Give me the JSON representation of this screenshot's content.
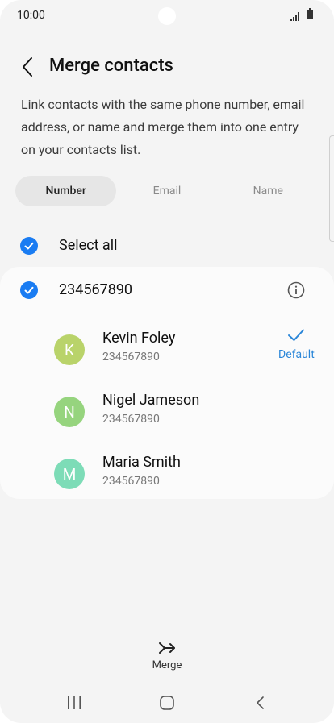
{
  "status_bar": {
    "time": "10:00"
  },
  "header": {
    "title": "Merge contacts"
  },
  "description": "Link contacts with the same phone number, email address, or name and merge them into one entry on your contacts list.",
  "tabs": [
    {
      "label": "Number",
      "active": true
    },
    {
      "label": "Email",
      "active": false
    },
    {
      "label": "Name",
      "active": false
    }
  ],
  "select_all": {
    "label": "Select all",
    "checked": true
  },
  "group": {
    "number": "234567890",
    "checked": true,
    "contacts": [
      {
        "initial": "K",
        "name": "Kevin Foley",
        "phone": "234567890",
        "avatar_color": "#b9d36a",
        "default": true,
        "default_label": "Default"
      },
      {
        "initial": "N",
        "name": "Nigel Jameson",
        "phone": "234567890",
        "avatar_color": "#96d47e"
      },
      {
        "initial": "M",
        "name": "Maria Smith",
        "phone": "234567890",
        "avatar_color": "#7ddcb7"
      }
    ]
  },
  "merge_button": {
    "label": "Merge"
  },
  "colors": {
    "accent": "#1a7cf2",
    "default_label": "#2a86d8"
  }
}
